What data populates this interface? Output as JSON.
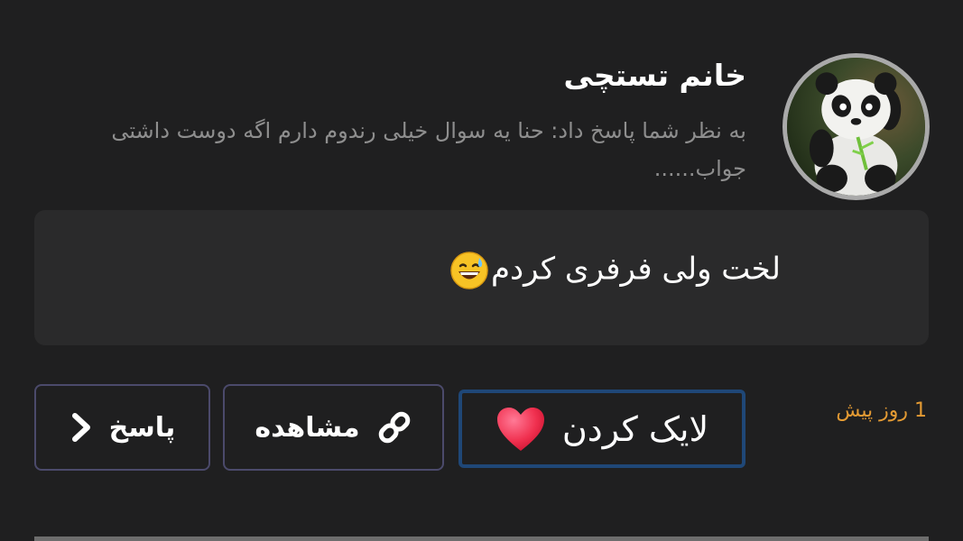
{
  "user": {
    "name": "خانم تستچی",
    "avatar_icon": "panda-avatar"
  },
  "reply_context": "به نظر شما پاسخ داد: حنا یه سوال خیلی رندوم دارم اگه دوست داشتی جواب......",
  "comment": {
    "text": "لخت ولی فرفری کردم",
    "emoji_icon": "grinning-sweat-emoji"
  },
  "actions": {
    "like_label": "لایک کردن",
    "like_icon": "red-heart-icon",
    "view_label": "مشاهده",
    "view_icon": "link-icon",
    "reply_label": "پاسخ",
    "reply_icon": "chevron-right-icon"
  },
  "time_ago": "1 روز پیش",
  "colors": {
    "background": "#1f1f20",
    "card": "#2a2a2b",
    "muted_text": "#8e8e8e",
    "accent_time": "#e39a33",
    "button_border": "#4b4a6b",
    "like_border": "#1f4777"
  }
}
